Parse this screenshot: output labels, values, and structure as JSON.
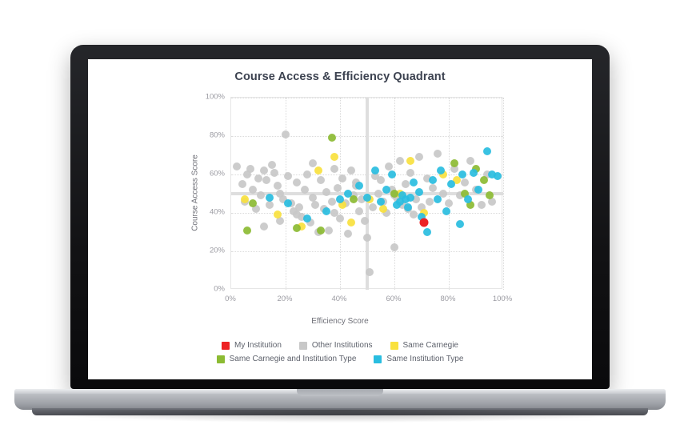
{
  "chart": {
    "title": "Course Access & Efficiency Quadrant",
    "x_axis_label": "Efficiency Score",
    "y_axis_label": "Course Access Score",
    "x_ticks": [
      "0%",
      "20%",
      "40%",
      "60%",
      "80%",
      "100%"
    ],
    "y_ticks": [
      "0%",
      "20%",
      "40%",
      "60%",
      "80%",
      "100%"
    ]
  },
  "legend": {
    "rows": [
      [
        {
          "label": "My Institution",
          "color": "#ed2224"
        },
        {
          "label": "Other Institutions",
          "color": "#c8c8c8"
        },
        {
          "label": "Same Carnegie",
          "color": "#f9e13e"
        }
      ],
      [
        {
          "label": "Same Carnegie and Institution Type",
          "color": "#8cbb33"
        },
        {
          "label": "Same Institution Type",
          "color": "#29bde0"
        }
      ]
    ]
  },
  "colors": {
    "my_institution": "#ed2224",
    "other_institutions": "#c8c8c8",
    "same_carnegie": "#f9e13e",
    "same_carnegie_and_type": "#8cbb33",
    "same_institution_type": "#29bde0",
    "quadrant_line": "#dedede",
    "gridline": "#dadada",
    "title_text": "#3c4250",
    "axis_text": "#9b9ba2"
  },
  "chart_data": {
    "type": "scatter",
    "title": "Course Access & Efficiency Quadrant",
    "xlabel": "Efficiency Score",
    "ylabel": "Course Access Score",
    "xlim": [
      0,
      100
    ],
    "ylim": [
      0,
      100
    ],
    "grid": true,
    "legend_position": "bottom",
    "quadrant_lines": {
      "x": 50,
      "y": 50
    },
    "series": [
      {
        "name": "My Institution",
        "color": "#ed2224",
        "points": [
          [
            71,
            35
          ]
        ]
      },
      {
        "name": "Other Institutions",
        "color": "#c8c8c8",
        "points": [
          [
            2,
            64
          ],
          [
            4,
            55
          ],
          [
            5,
            46
          ],
          [
            6,
            60
          ],
          [
            7,
            63
          ],
          [
            8,
            52
          ],
          [
            9,
            42
          ],
          [
            10,
            58
          ],
          [
            11,
            49
          ],
          [
            12,
            62
          ],
          [
            13,
            57
          ],
          [
            14,
            44
          ],
          [
            15,
            65
          ],
          [
            16,
            61
          ],
          [
            17,
            54
          ],
          [
            18,
            50
          ],
          [
            19,
            47
          ],
          [
            20,
            81
          ],
          [
            21,
            59
          ],
          [
            22,
            45
          ],
          [
            23,
            41
          ],
          [
            24,
            56
          ],
          [
            25,
            43
          ],
          [
            26,
            38
          ],
          [
            27,
            52
          ],
          [
            28,
            60
          ],
          [
            29,
            35
          ],
          [
            30,
            48
          ],
          [
            31,
            44
          ],
          [
            32,
            30
          ],
          [
            33,
            57
          ],
          [
            34,
            42
          ],
          [
            35,
            51
          ],
          [
            36,
            31
          ],
          [
            37,
            46
          ],
          [
            38,
            40
          ],
          [
            39,
            53
          ],
          [
            40,
            37
          ],
          [
            41,
            58
          ],
          [
            42,
            45
          ],
          [
            43,
            29
          ],
          [
            44,
            62
          ],
          [
            45,
            49
          ],
          [
            46,
            54
          ],
          [
            47,
            41
          ],
          [
            48,
            47
          ],
          [
            49,
            36
          ],
          [
            50,
            27
          ],
          [
            51,
            9
          ],
          [
            52,
            43
          ],
          [
            53,
            59
          ],
          [
            54,
            50
          ],
          [
            55,
            57
          ],
          [
            56,
            46
          ],
          [
            57,
            40
          ],
          [
            58,
            64
          ],
          [
            59,
            52
          ],
          [
            60,
            22
          ],
          [
            61,
            48
          ],
          [
            62,
            67
          ],
          [
            63,
            44
          ],
          [
            64,
            55
          ],
          [
            65,
            42
          ],
          [
            66,
            61
          ],
          [
            67,
            39
          ],
          [
            68,
            47
          ],
          [
            69,
            69
          ],
          [
            70,
            43
          ],
          [
            72,
            58
          ],
          [
            73,
            46
          ],
          [
            74,
            53
          ],
          [
            76,
            71
          ],
          [
            78,
            50
          ],
          [
            80,
            45
          ],
          [
            82,
            63
          ],
          [
            84,
            49
          ],
          [
            86,
            56
          ],
          [
            88,
            67
          ],
          [
            90,
            52
          ],
          [
            92,
            44
          ],
          [
            94,
            60
          ],
          [
            96,
            46
          ],
          [
            60,
            49
          ],
          [
            46,
            56
          ],
          [
            38,
            63
          ],
          [
            30,
            66
          ],
          [
            24,
            39
          ],
          [
            18,
            36
          ],
          [
            12,
            33
          ]
        ]
      },
      {
        "name": "Same Carnegie",
        "color": "#f9e13e",
        "points": [
          [
            5,
            47
          ],
          [
            17,
            39
          ],
          [
            26,
            33
          ],
          [
            32,
            62
          ],
          [
            38,
            69
          ],
          [
            41,
            44
          ],
          [
            44,
            35
          ],
          [
            51,
            47
          ],
          [
            56,
            42
          ],
          [
            62,
            50
          ],
          [
            66,
            67
          ],
          [
            71,
            40
          ],
          [
            78,
            60
          ],
          [
            83,
            57
          ]
        ]
      },
      {
        "name": "Same Carnegie and Institution Type",
        "color": "#8cbb33",
        "points": [
          [
            6,
            31
          ],
          [
            8,
            45
          ],
          [
            24,
            32
          ],
          [
            33,
            31
          ],
          [
            37,
            79
          ],
          [
            45,
            47
          ],
          [
            60,
            50
          ],
          [
            82,
            66
          ],
          [
            86,
            50
          ],
          [
            88,
            44
          ],
          [
            90,
            63
          ],
          [
            93,
            57
          ],
          [
            95,
            49
          ]
        ]
      },
      {
        "name": "Same Institution Type",
        "color": "#29bde0",
        "points": [
          [
            14,
            48
          ],
          [
            21,
            45
          ],
          [
            28,
            37
          ],
          [
            35,
            41
          ],
          [
            40,
            47
          ],
          [
            43,
            50
          ],
          [
            47,
            54
          ],
          [
            50,
            48
          ],
          [
            53,
            62
          ],
          [
            55,
            46
          ],
          [
            57,
            52
          ],
          [
            59,
            60
          ],
          [
            61,
            44
          ],
          [
            63,
            49
          ],
          [
            65,
            43
          ],
          [
            67,
            56
          ],
          [
            69,
            51
          ],
          [
            70,
            38
          ],
          [
            72,
            30
          ],
          [
            74,
            57
          ],
          [
            76,
            47
          ],
          [
            77,
            62
          ],
          [
            79,
            41
          ],
          [
            81,
            55
          ],
          [
            84,
            34
          ],
          [
            85,
            60
          ],
          [
            87,
            47
          ],
          [
            89,
            61
          ],
          [
            91,
            52
          ],
          [
            94,
            72
          ],
          [
            96,
            60
          ],
          [
            98,
            59
          ],
          [
            66,
            48
          ],
          [
            64,
            47
          ],
          [
            62,
            46
          ]
        ]
      }
    ]
  }
}
